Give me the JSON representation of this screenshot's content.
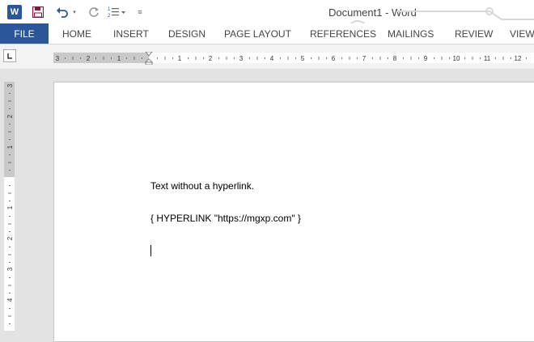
{
  "app": {
    "logo_letter": "W",
    "title": "Document1 - Word",
    "qat": {
      "save_icon": "floppy-disk-icon",
      "undo_icon": "undo-arrow-icon",
      "redo_icon": "redo-arrow-icon",
      "list_icon": "numbering-list-icon",
      "customize_icon": "customize-dropdown-icon",
      "customize_glyph": "≡",
      "undo_dropdown_glyph": "▾"
    }
  },
  "ribbon": {
    "file_label": "FILE",
    "tabs": [
      "HOME",
      "INSERT",
      "DESIGN",
      "PAGE LAYOUT",
      "REFERENCES",
      "MAILINGS",
      "REVIEW",
      "VIEW"
    ]
  },
  "ruler": {
    "horizontal_left_numbers": [
      "3",
      "2",
      "1"
    ],
    "horizontal_right_numbers": [
      "1",
      "2",
      "3",
      "4",
      "5",
      "6",
      "7",
      "8",
      "9",
      "10",
      "11",
      "12"
    ],
    "vertical_top_numbers": [
      "3",
      "2",
      "1"
    ],
    "vertical_bottom_numbers": [
      "1",
      "2",
      "3",
      "4"
    ]
  },
  "document": {
    "lines": [
      "Text without a hyperlink.",
      "{ HYPERLINK \"https://mgxp.com\" }"
    ]
  },
  "colors": {
    "brand_blue": "#2b579a",
    "page_bg": "#ffffff",
    "workspace_bg": "#e3e3e3"
  }
}
